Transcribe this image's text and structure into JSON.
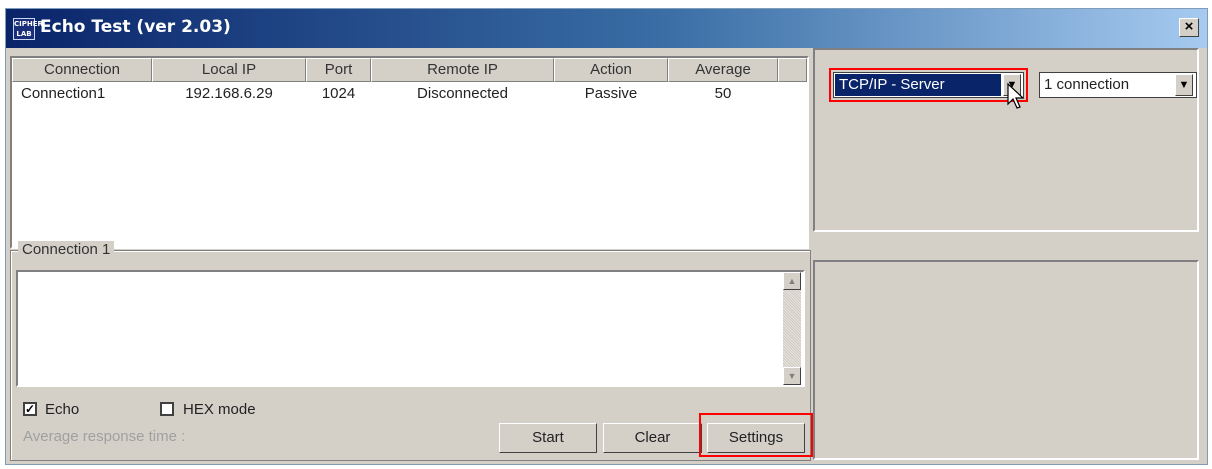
{
  "window": {
    "title": "Echo Test (ver 2.03)",
    "logo_text_top": "CIPHER",
    "logo_text_bottom": "LAB",
    "close_label": "×"
  },
  "connections_table": {
    "columns": [
      "Connection",
      "Local IP",
      "Port",
      "Remote IP",
      "Action",
      "Average"
    ],
    "rows": [
      {
        "connection": "Connection1",
        "local_ip": "192.168.6.29",
        "port": "1024",
        "remote_ip": "Disconnected",
        "action": "Passive",
        "average": "50"
      }
    ]
  },
  "protocol_select": {
    "value": "TCP/IP - Server",
    "arrow": "▼"
  },
  "connections_select": {
    "value": "1 connection",
    "arrow": "▼"
  },
  "connection_group": {
    "title": "Connection 1",
    "scroll_up": "▲",
    "scroll_down": "▼",
    "echo_checkbox": {
      "label": "Echo",
      "checked": true,
      "mark": "✓"
    },
    "hex_checkbox": {
      "label": "HEX mode",
      "checked": false
    },
    "avg_label": "Average response time :",
    "buttons": {
      "start": "Start",
      "clear": "Clear",
      "settings": "Settings"
    }
  },
  "colors": {
    "highlight_outline": "#ff0000",
    "selection": "#0a246a",
    "titlebar_start": "#0a246a"
  }
}
